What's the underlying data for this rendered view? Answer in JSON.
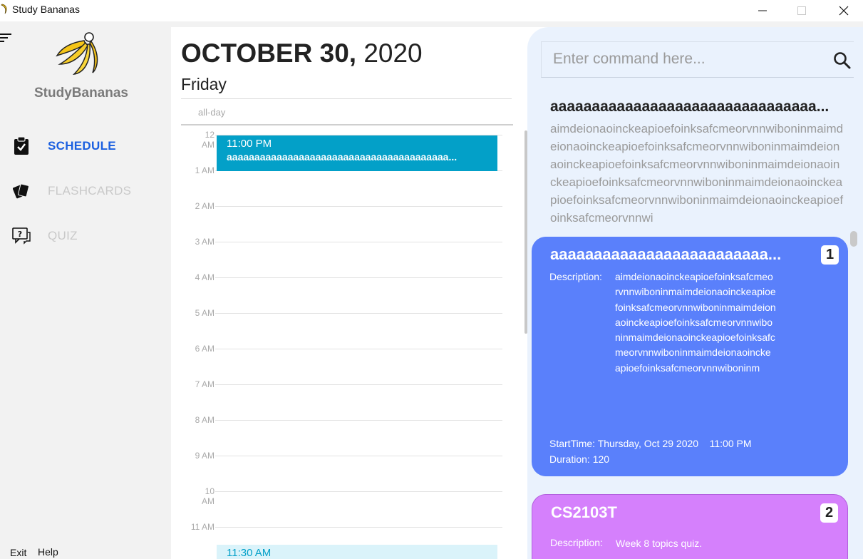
{
  "window": {
    "title": "Study Bananas"
  },
  "sidebar": {
    "brand": "StudyBananas",
    "items": [
      {
        "label": "SCHEDULE",
        "icon": "clipboard-check-icon",
        "active": true
      },
      {
        "label": "FLASHCARDS",
        "icon": "cards-icon",
        "active": false
      },
      {
        "label": "QUIZ",
        "icon": "quiz-chat-icon",
        "active": false
      }
    ],
    "footer": {
      "exit": "Exit",
      "help": "Help"
    }
  },
  "calendar": {
    "month_day": "OCTOBER 30,",
    "year": "2020",
    "weekday": "Friday",
    "allday_label": "all-day",
    "hours": [
      "12 AM",
      "1 AM",
      "2 AM",
      "3 AM",
      "4 AM",
      "5 AM",
      "6 AM",
      "7 AM",
      "8 AM",
      "9 AM",
      "10 AM",
      "11 AM"
    ],
    "event": {
      "time": "11:00 PM",
      "title": "aaaaaaaaaaaaaaaaaaaaaaaaaaaaaaaaaaaaaaaa..."
    },
    "event2": {
      "time": "11:30 AM"
    }
  },
  "command": {
    "placeholder": "Enter command here..."
  },
  "result": {
    "title": "aaaaaaaaaaaaaaaaaaaaaaaaaaaaaaaa...",
    "body": "aimdeionaoinckeapioefoinksafcmeorvnnwiboninmaimdeionaoinckeapioefoinksafcmeorvnnwiboninmaimdeionaoinckeapioefoinksafcmeorvnnwiboninmaimdeionaoinckeapioefoinksafcmeorvnnwiboninmaimdeionaoinckeapioefoinksafcmeorvnnwiboninmaimdeionaoinckeapioefoinksafcmeorvnnwi"
  },
  "cards": [
    {
      "index": "1",
      "title": "aaaaaaaaaaaaaaaaaaaaaaaaa...",
      "description_label": "Description:",
      "description": "aimdeionaoinckeapioefoinksafcmeorvnnwiboninmaimdeionaoinckeapioefoinksafcmeorvnnwiboninmaimdeionaoinckeapioefoinksafcmeorvnnwiboninmaimdeionaoinckeapioefoinksafcmeorvnnwiboninmaimdeionaoinckeapioefoinksafcmeorvnnwiboninm",
      "start_label": "StartTime:",
      "start_value": "Thursday, Oct 29 2020    11:00 PM",
      "duration_label": "Duration:",
      "duration_value": "120",
      "color": "#5a80fb"
    },
    {
      "index": "2",
      "title": "CS2103T",
      "description_label": "Description:",
      "description": "Week 8 topics quiz.",
      "color": "#d580fc"
    }
  ],
  "colors": {
    "accent": "#1a5fe0",
    "event": "#03a0c8",
    "panel_bg": "#eaf2fd"
  }
}
